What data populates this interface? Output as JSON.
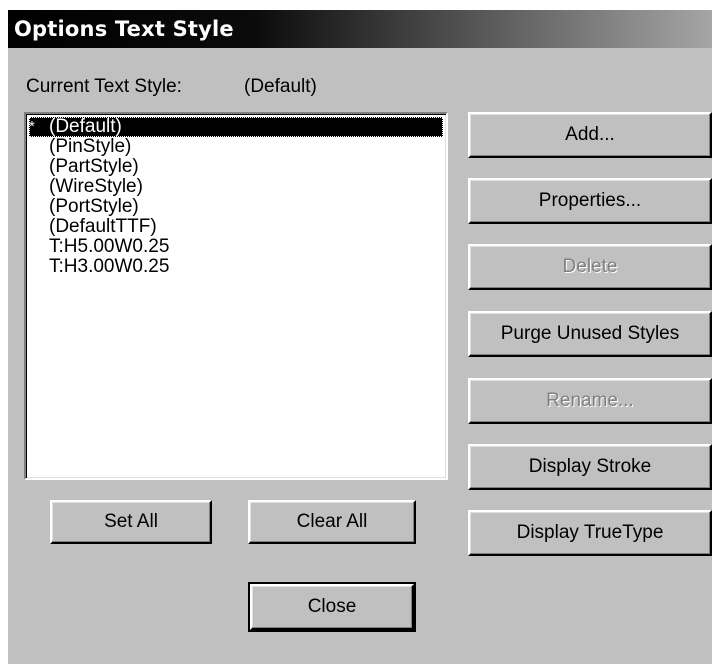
{
  "dialog": {
    "title": "Options Text Style",
    "current_label": "Current Text Style:",
    "current_value": "(Default)"
  },
  "styles": {
    "selected_marker": "*",
    "items": [
      "(Default)",
      "(PinStyle)",
      "(PartStyle)",
      "(WireStyle)",
      "(PortStyle)",
      "(DefaultTTF)",
      "T:H5.00W0.25",
      "T:H3.00W0.25"
    ]
  },
  "buttons": {
    "add": "Add...",
    "properties": "Properties...",
    "delete": "Delete",
    "purge": "Purge Unused Styles",
    "rename": "Rename...",
    "display_stroke": "Display Stroke",
    "display_truetype": "Display TrueType",
    "set_all": "Set All",
    "clear_all": "Clear All",
    "close": "Close"
  },
  "state": {
    "delete_enabled": false,
    "rename_enabled": false
  }
}
